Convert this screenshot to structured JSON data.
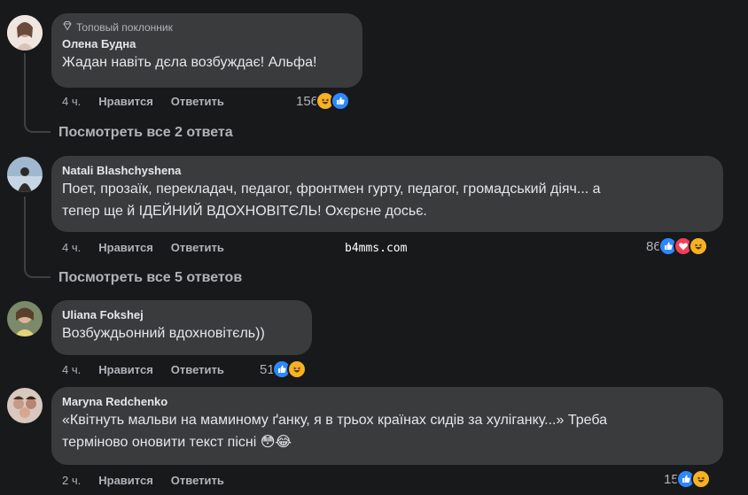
{
  "watermark": "b4mms.com",
  "comments": [
    {
      "badge": "Топовый поклонник",
      "author": "Олена Будна",
      "text_lines": [
        "Жадан навіть дєла возбуждає! Альфа!"
      ],
      "time": "4 ч.",
      "like_label": "Нравится",
      "reply_label": "Ответить",
      "reaction_count": "156",
      "reactions": [
        "haha",
        "like"
      ]
    },
    {
      "author": "Natali Blashchyshena",
      "text_lines": [
        "Поет, прозаїк, перекладач, педагог, фронтмен гурту, педагог, громадський діяч... а",
        "тепер ще й ІДЕЙНИЙ ВДОХНОВІТЄЛЬ! Охєрєне досьє."
      ],
      "time": "4 ч.",
      "like_label": "Нравится",
      "reply_label": "Ответить",
      "reaction_count": "86",
      "reactions": [
        "like",
        "love",
        "haha"
      ]
    },
    {
      "author": "Uliana Fokshej",
      "text_lines": [
        "Возбуждьонний вдохновітєль))"
      ],
      "time": "4 ч.",
      "like_label": "Нравится",
      "reply_label": "Ответить",
      "reaction_count": "51",
      "reactions": [
        "like",
        "haha"
      ]
    },
    {
      "author": "Maryna Redchenko",
      "text_lines": [
        "«Квітнуть мальви на маминому ґанку, я в трьох країнах сидів за хуліганку...» Треба",
        "терміново оновити текст пісні 😳😂"
      ],
      "time": "2 ч.",
      "like_label": "Нравится",
      "reply_label": "Ответить",
      "reaction_count": "15",
      "reactions": [
        "like",
        "haha"
      ]
    }
  ],
  "view_replies": [
    "Посмотреть все 2 ответа",
    "Посмотреть все 5 ответов"
  ],
  "colors": {
    "background": "#18191a",
    "bubble": "#3a3b3c",
    "text": "#e4e6eb",
    "muted": "#b0b3b8",
    "like": "#2d88ff",
    "love": "#f33e58",
    "haha": "#f7b125"
  }
}
